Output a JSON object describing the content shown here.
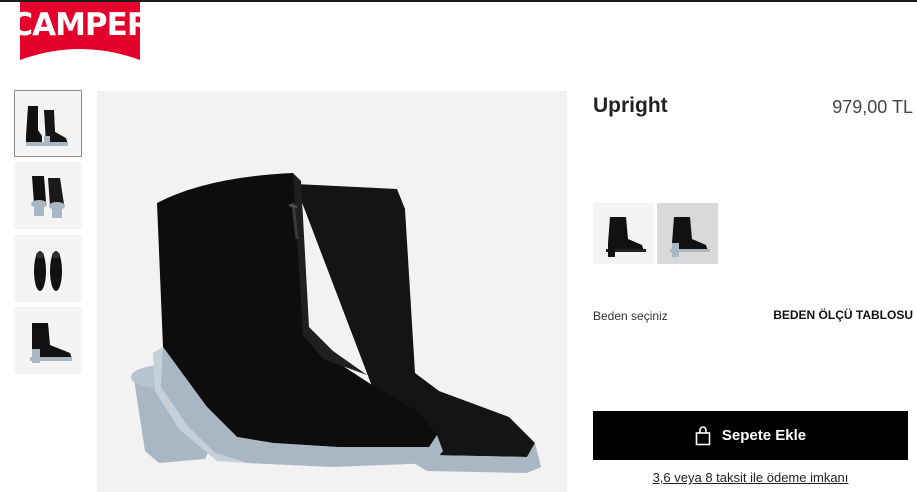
{
  "brand": {
    "logo_text": "CAMPER",
    "logo_color": "#e4002b"
  },
  "gallery": {
    "thumbnails": [
      {
        "view": "pair-side",
        "active": true
      },
      {
        "view": "pair-back",
        "active": false
      },
      {
        "view": "top",
        "active": false
      },
      {
        "view": "single-side",
        "active": false
      }
    ],
    "main_view": "pair-three-quarter"
  },
  "product": {
    "name": "Upright",
    "price": "979,00 TL"
  },
  "colors": {
    "swatches": [
      {
        "name": "black",
        "selected": false
      },
      {
        "name": "black-grey",
        "selected": true
      }
    ]
  },
  "size": {
    "label": "Beden seçiniz",
    "table_link": "BEDEN ÖLÇÜ TABLOSU"
  },
  "cart": {
    "button_label": "Sepete Ekle",
    "icon": "shopping-bag-icon"
  },
  "payment": {
    "installment_text": "3,6 veya 8 taksit ile ödeme imkanı"
  },
  "theme": {
    "sole_color": "#a9b6c4",
    "leather_color": "#111111",
    "button_color": "#000000"
  }
}
